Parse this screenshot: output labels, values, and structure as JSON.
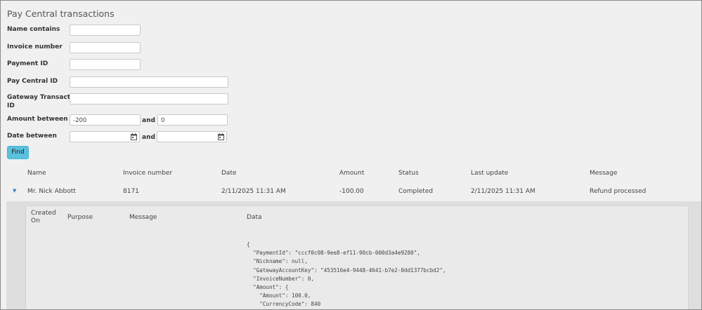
{
  "page_title": "Pay Central transactions",
  "filters": {
    "name_label": "Name contains",
    "invoice_label": "Invoice number",
    "payment_id_label": "Payment ID",
    "pay_central_id_label": "Pay Central ID",
    "gateway_label_line1": "Gateway Transaction",
    "gateway_label_line2": "ID",
    "amount_label": "Amount between",
    "amount_from": "-200",
    "amount_to": "0",
    "and_label": "and",
    "date_label": "Date between",
    "find_label": "Find"
  },
  "table": {
    "columns": [
      "Name",
      "Invoice number",
      "Date",
      "Amount",
      "Status",
      "Last update",
      "Message"
    ],
    "rows": [
      {
        "name": "Mr. Nick Abbott",
        "invoice_number": "8171",
        "date": "2/11/2025 11:31 AM",
        "amount": "-100.00",
        "status": "Completed",
        "last_update": "2/11/2025 11:31 AM",
        "message": "Refund processed"
      }
    ],
    "expand_glyph": "▼"
  },
  "detail": {
    "columns": {
      "created_on_line1": "Created",
      "created_on_line2": "On",
      "purpose": "Purpose",
      "message": "Message",
      "data": "Data"
    },
    "data_json": "{\n  \"PaymentId\": \"cccf0c08-9ee8-ef11-90cb-000d3a4e9280\",\n  \"Nickname\": null,\n  \"GatewayAccountKey\": \"453516e4-9448-4641-b7e2-0dd1377bcbd2\",\n  \"InvoiceNumber\": 0,\n  \"Amount\": {\n    \"Amount\": 100.0,\n    \"CurrencyCode\": 840\n  },"
  },
  "colors": {
    "background": "#f0f0f0",
    "find_button": "#5bc0de",
    "expand_arrow": "#3a7fc0"
  }
}
